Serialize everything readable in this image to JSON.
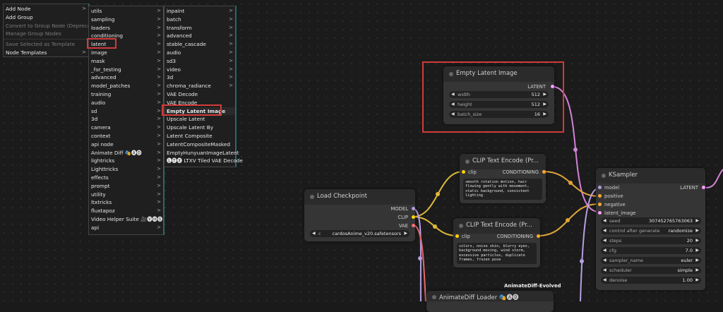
{
  "colors": {
    "accent_red": "#d23a3a",
    "menu_border": "#2a6a66",
    "wire_pink": "#d283d8",
    "wire_yellow": "#e0b93a",
    "wire_purple": "#b69fe3",
    "wire_red": "#e56a6a",
    "pin_latent": "#ff9cf9",
    "pin_clip": "#ffd500",
    "pin_cond": "#ffa931",
    "pin_model": "#b39ddb",
    "pin_vae": "#ff6e6e"
  },
  "menu_main": {
    "items": [
      {
        "label": "Add Node",
        "arrow": ">"
      },
      {
        "label": "Add Group",
        "arrow": ""
      },
      {
        "label": "Convert to Group Node (Deprecated)",
        "arrow": ""
      },
      {
        "label": "Manage Group Nodes",
        "arrow": ""
      },
      {
        "label": "Save Selected as Template",
        "arrow": ""
      },
      {
        "label": "Node Templates",
        "arrow": ">"
      }
    ]
  },
  "menu_categories": {
    "items": [
      "utils",
      "sampling",
      "loaders",
      "conditioning",
      "latent",
      "image",
      "mask",
      "_for_testing",
      "advanced",
      "model_patches",
      "training",
      "audio",
      "sd",
      "3d",
      "camera",
      "context",
      "api node",
      "Animate Diff 🎭🅐🅓",
      "lightricks",
      "Lighttricks",
      "effects",
      "prompt",
      "utility",
      "ltxtricks",
      "fluxtapoz",
      "Video Helper Suite 🎥🅥🅗🅢",
      "api"
    ],
    "arrow": ">"
  },
  "menu_latent": {
    "items": [
      "inpaint",
      "batch",
      "transform",
      "advanced",
      "stable_cascade",
      "audio",
      "sd3",
      "video",
      "3d",
      "chroma_radiance",
      "VAE Decode",
      "VAE Encode",
      "Empty Latent Image",
      "Upscale Latent",
      "Upscale Latent By",
      "Latent Composite",
      "LatentCompositeMasked",
      "EmptyHunyuanImageLatent",
      "🅛🅣🅧 LTXV Tiled VAE Decode"
    ],
    "arrow": ">"
  },
  "node_empty_latent": {
    "title": "Empty Latent Image",
    "output": "LATENT",
    "widgets": [
      {
        "label": "width",
        "value": "512"
      },
      {
        "label": "height",
        "value": "512"
      },
      {
        "label": "batch_size",
        "value": "16"
      }
    ]
  },
  "node_clip_pos": {
    "title": "CLIP Text Encode (Pr...",
    "input": "clip",
    "output": "CONDITIONING",
    "text": "smooth rotation motion, hair flowing gently with movement, static background, consistent lighting"
  },
  "node_clip_neg": {
    "title": "CLIP Text Encode (Pr...",
    "input": "clip",
    "output": "CONDITIONING",
    "text": "colors, noise skin, blurry eyes, background moving, wind storm, excessive particles, duplicate frames, frozen pose"
  },
  "node_checkpoint": {
    "title": "Load Checkpoint",
    "outputs": [
      "MODEL",
      "CLIP",
      "VAE"
    ],
    "ckpt_prefix": "c",
    "ckpt_name": "cardosAnime_v20.safetensors"
  },
  "node_ksampler": {
    "title": "KSampler",
    "inputs": [
      "model",
      "positive",
      "negative",
      "latent_image"
    ],
    "output": "LATENT",
    "widgets": [
      {
        "label": "seed",
        "value": "307452765763063"
      },
      {
        "label": "control after generate",
        "value": "randomize"
      },
      {
        "label": "steps",
        "value": "20"
      },
      {
        "label": "cfg",
        "value": "7.0"
      },
      {
        "label": "sampler_name",
        "value": "euler"
      },
      {
        "label": "scheduler",
        "value": "simple"
      },
      {
        "label": "denoise",
        "value": "1.00"
      }
    ]
  },
  "node_animatediff": {
    "title": "AnimateDiff Loader 🎭🅐🅓",
    "group_label": "AnimateDiff-Evolved"
  }
}
